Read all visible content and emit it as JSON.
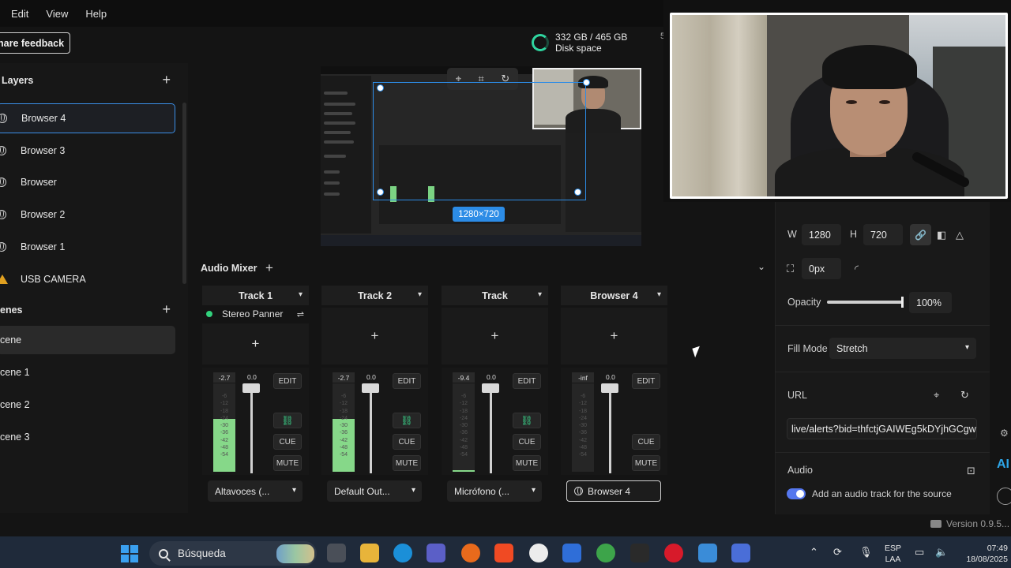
{
  "menu": {
    "items": [
      "Edit",
      "View",
      "Help"
    ]
  },
  "share_feedback": {
    "label": "hare feedback"
  },
  "disk": {
    "usage": "332 GB / 465 GB",
    "label": "Disk space",
    "extra": "5"
  },
  "layers": {
    "title": "Layers",
    "items": [
      {
        "label": "Browser 4",
        "icon": "globe-icon",
        "selected": true
      },
      {
        "label": "Browser 3",
        "icon": "globe-icon"
      },
      {
        "label": "Browser",
        "icon": "globe-icon"
      },
      {
        "label": "Browser 2",
        "icon": "globe-icon"
      },
      {
        "label": "Browser 1",
        "icon": "globe-icon"
      },
      {
        "label": "USB CAMERA",
        "icon": "warning-icon"
      }
    ]
  },
  "scenes": {
    "title": "enes",
    "items": [
      {
        "label": "cene",
        "active": true
      },
      {
        "label": "cene 1"
      },
      {
        "label": "cene 2"
      },
      {
        "label": "cene 3"
      }
    ]
  },
  "preview": {
    "size_label": "1280×720"
  },
  "mixer": {
    "title": "Audio Mixer",
    "edit": "EDIT",
    "cue": "CUE",
    "mute": "MUTE",
    "tracks": [
      {
        "name": "Track 1",
        "level": "-2.7",
        "fader": "0.0",
        "output": "Altavoces (...",
        "fill": 0.6,
        "effect": "Stereo Panner",
        "link": true
      },
      {
        "name": "Track 2",
        "level": "-2.7",
        "fader": "0.0",
        "output": "Default Out...",
        "fill": 0.6,
        "link": true
      },
      {
        "name": "Track",
        "level": "-9.4",
        "fader": "0.0",
        "output": "Micrófono (...",
        "fill": 0.02,
        "link": true
      },
      {
        "name": "Browser 4",
        "level": "-inf",
        "fader": "0.0",
        "output": "Browser 4",
        "fill": 0.0,
        "link": false
      }
    ],
    "meter_ticks": [
      "-6",
      "-12",
      "-18",
      "-24",
      "-30",
      "-36",
      "-42",
      "-48",
      "-54"
    ]
  },
  "properties": {
    "w_label": "W",
    "w_value": "1280",
    "h_label": "H",
    "h_value": "720",
    "radius_value": "0px",
    "opacity_label": "Opacity",
    "opacity_value": "100%",
    "opacity": 1.0,
    "fill_mode_label": "Fill Mode",
    "fill_mode_value": "Stretch",
    "url_label": "URL",
    "url_value": "live/alerts?bid=thfctjGAIWEg5kDYjhGCgw",
    "audio_label": "Audio",
    "audio_toggle_label": "Add an audio track for the source"
  },
  "version": {
    "label": "Version 0.9.5..."
  },
  "taskbar": {
    "search_placeholder": "Búsqueda",
    "lang_top": "ESP",
    "lang_bottom": "LAA",
    "time": "07:49",
    "date": "18/08/2025"
  }
}
